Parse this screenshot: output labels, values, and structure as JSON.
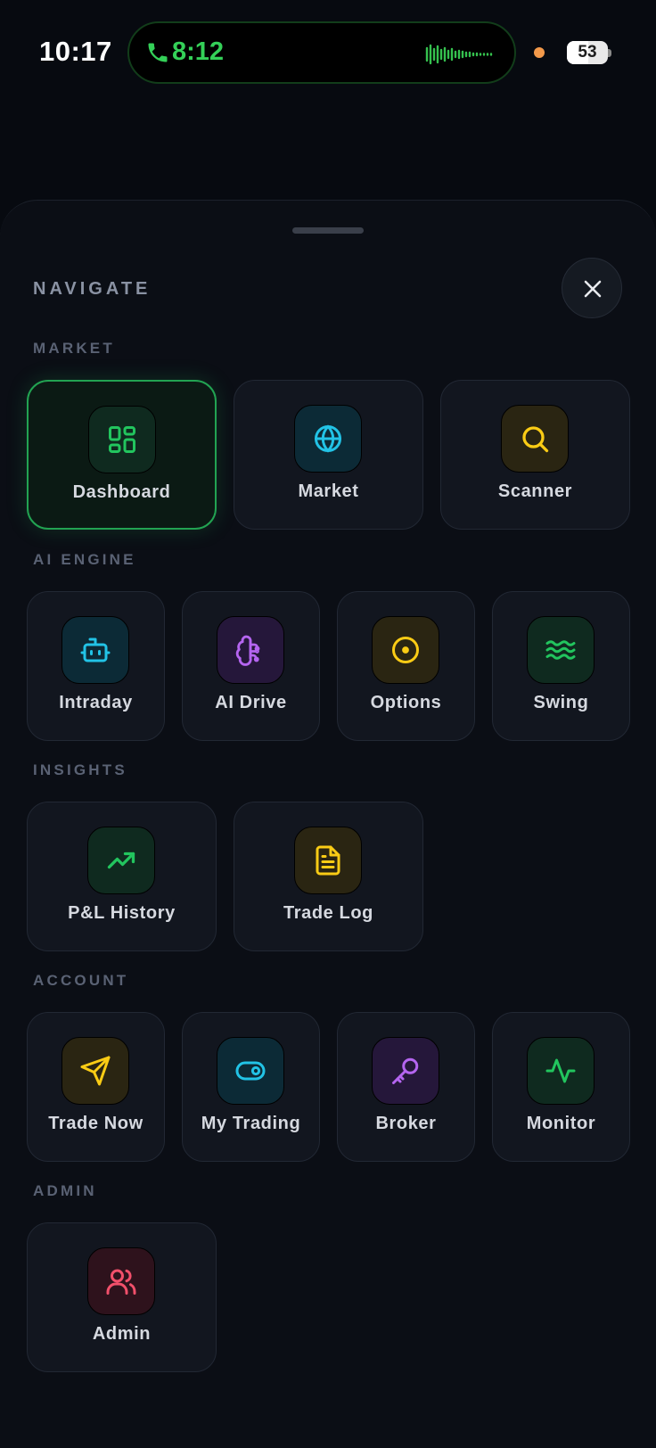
{
  "status": {
    "time": "10:17",
    "call_duration": "8:12",
    "battery": "53",
    "battery_level": 0.53
  },
  "sheet": {
    "title": "NAVIGATE"
  },
  "sections": {
    "market": {
      "label": "MARKET",
      "items": [
        {
          "label": "Dashboard",
          "icon": "dashboard-icon",
          "active": true
        },
        {
          "label": "Market",
          "icon": "globe-icon"
        },
        {
          "label": "Scanner",
          "icon": "search-icon"
        }
      ]
    },
    "ai_engine": {
      "label": "AI ENGINE",
      "items": [
        {
          "label": "Intraday",
          "icon": "bot-icon"
        },
        {
          "label": "AI Drive",
          "icon": "brain-icon"
        },
        {
          "label": "Options",
          "icon": "target-icon"
        },
        {
          "label": "Swing",
          "icon": "waves-icon"
        }
      ]
    },
    "insights": {
      "label": "INSIGHTS",
      "items": [
        {
          "label": "P&L History",
          "icon": "trending-up-icon"
        },
        {
          "label": "Trade Log",
          "icon": "document-icon"
        }
      ]
    },
    "account": {
      "label": "ACCOUNT",
      "items": [
        {
          "label": "Trade Now",
          "icon": "send-icon"
        },
        {
          "label": "My Trading",
          "icon": "toggle-icon"
        },
        {
          "label": "Broker",
          "icon": "key-icon"
        },
        {
          "label": "Monitor",
          "icon": "activity-icon"
        }
      ]
    },
    "admin": {
      "label": "ADMIN",
      "items": [
        {
          "label": "Admin",
          "icon": "users-icon"
        }
      ]
    }
  },
  "colors": {
    "green": "#22c55e",
    "cyan": "#22c3e6",
    "yellow": "#facc15",
    "purple": "#b565f0",
    "red": "#f2506b",
    "background": "#070a10"
  }
}
